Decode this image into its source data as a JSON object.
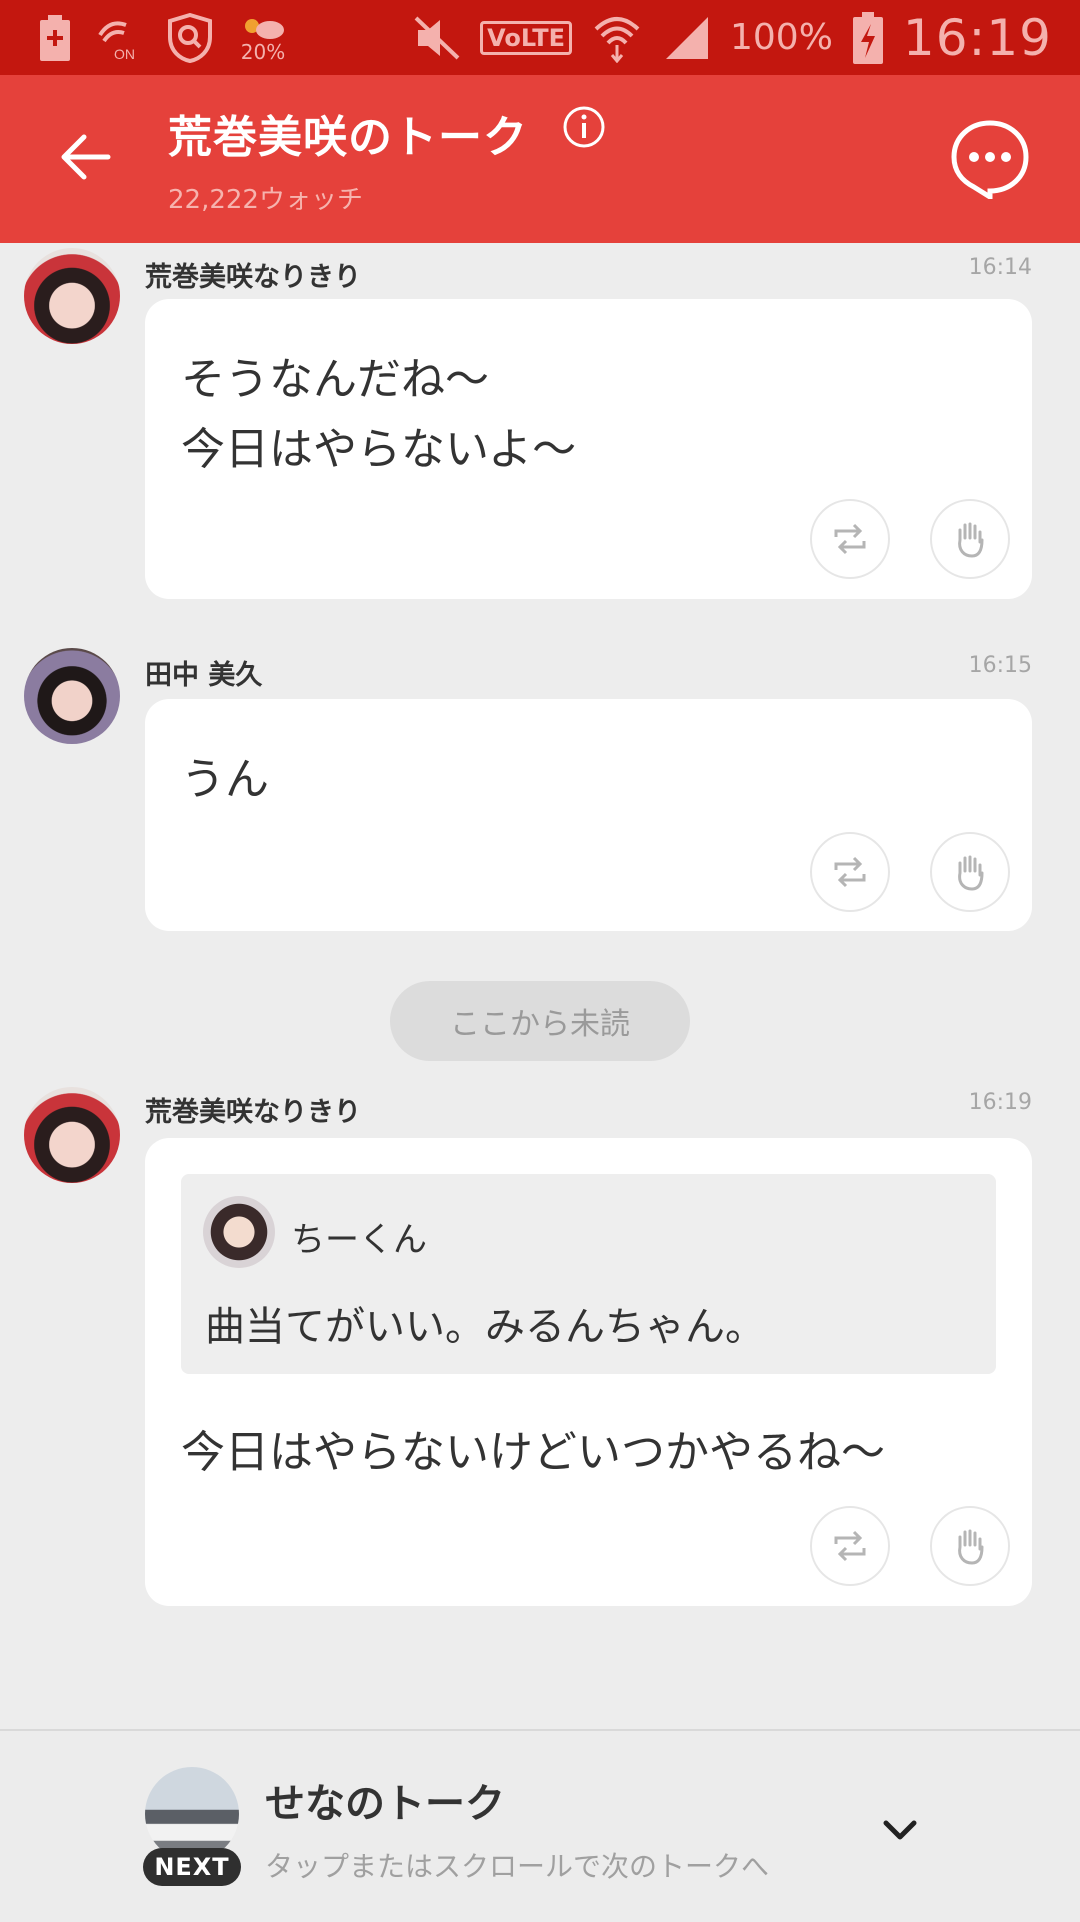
{
  "status_bar": {
    "weather_percent": "20%",
    "nfc_label": "ON",
    "volte_label": "VoLTE",
    "battery_percent": "100%",
    "time": "16:19"
  },
  "header": {
    "title": "荒巻美咲のトーク",
    "watch_count": "22,222ウォッチ"
  },
  "messages": [
    {
      "name": "荒巻美咲なりきり",
      "time": "16:14",
      "text": "そうなんだね〜\n今日はやらないよ〜"
    },
    {
      "name": "田中 美久",
      "time": "16:15",
      "text": "うん"
    },
    {
      "name": "荒巻美咲なりきり",
      "time": "16:19",
      "quote": {
        "name": "ちーくん",
        "text": "曲当てがいい。みるんちゃん。"
      },
      "text": "今日はやらないけどいつかやるね〜"
    }
  ],
  "unread_divider": "ここから未読",
  "next_talk": {
    "badge": "NEXT",
    "title": "せなのトーク",
    "subtitle": "タップまたはスクロールで次のトークへ"
  },
  "colors": {
    "status_bar": "#c3170f",
    "header": "#e5413b",
    "background": "#ededed"
  }
}
